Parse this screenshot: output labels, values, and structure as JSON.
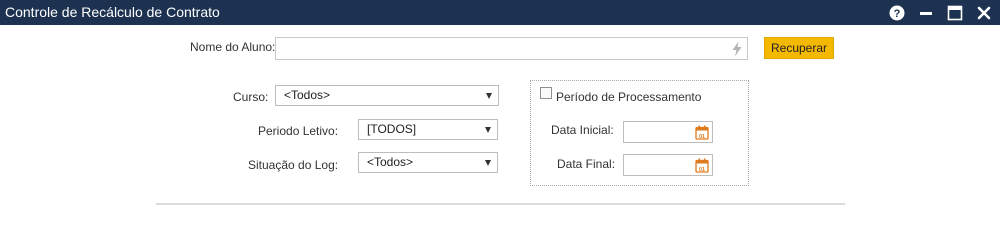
{
  "window": {
    "title": "Controle de Recálculo de Contrato",
    "controls": {
      "help_icon": "question-circle",
      "minimize_icon": "minimize",
      "maximize_icon": "maximize-window",
      "close_icon": "close-x"
    }
  },
  "form": {
    "aluno": {
      "label": "Nome do Aluno:",
      "value": "",
      "icon": "lightning-bolt"
    },
    "recuperar_label": "Recuperar",
    "curso": {
      "label": "Curso:",
      "value": "<Todos>"
    },
    "periodo_letivo": {
      "label": "Periodo Letivo:",
      "value": "[TODOS]"
    },
    "situacao_log": {
      "label": "Situação do Log:",
      "value": "<Todos>"
    },
    "periodo_processamento": {
      "label": "Período de Processamento",
      "checked": false,
      "data_inicial": {
        "label": "Data Inicial:",
        "value": "",
        "icon": "calendar"
      },
      "data_final": {
        "label": "Data Final:",
        "value": "",
        "icon": "calendar"
      }
    }
  },
  "colors": {
    "titlebar_bg": "#1c3250",
    "accent_button": "#f5b800",
    "calendar_icon": "#e07a1f"
  }
}
